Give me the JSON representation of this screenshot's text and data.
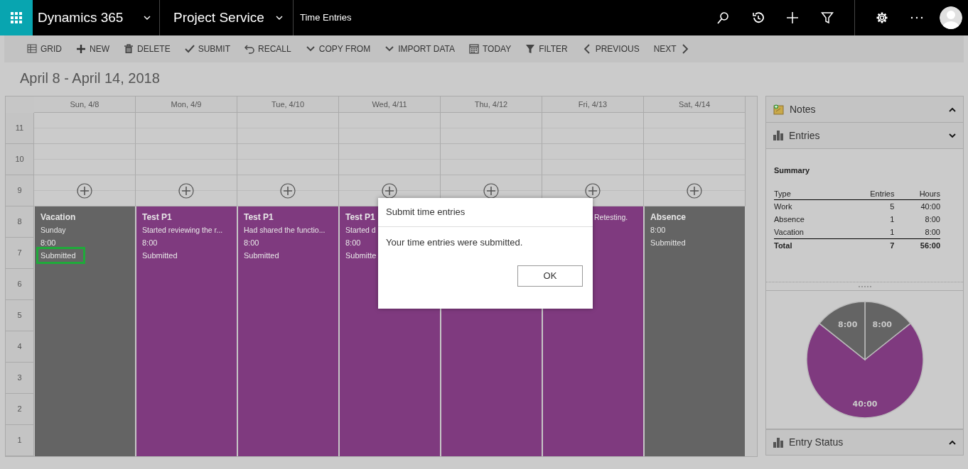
{
  "app_bar": {
    "app_name": "Dynamics 365",
    "area": "Project Service",
    "page": "Time Entries"
  },
  "toolbar": [
    {
      "label": "GRID"
    },
    {
      "label": "NEW"
    },
    {
      "label": "DELETE"
    },
    {
      "label": "SUBMIT"
    },
    {
      "label": "RECALL"
    },
    {
      "label": "COPY FROM"
    },
    {
      "label": "IMPORT DATA"
    },
    {
      "label": "TODAY"
    },
    {
      "label": "FILTER"
    },
    {
      "label": "PREVIOUS"
    },
    {
      "label": "NEXT"
    }
  ],
  "date_range": "April 8 - April 14, 2018",
  "calendar": {
    "hours": [
      "11",
      "10",
      "9",
      "8",
      "7",
      "6",
      "5",
      "4",
      "3",
      "2",
      "1"
    ],
    "days": [
      {
        "label": "Sun, 4/8",
        "entry": {
          "kind": "vacation",
          "title": "Vacation",
          "description": "Sunday",
          "hours": "8:00",
          "status": "Submitted",
          "highlighted": true
        }
      },
      {
        "label": "Mon, 4/9",
        "entry": {
          "kind": "work",
          "title": "Test P1",
          "description": "Started reviewing the r...",
          "hours": "8:00",
          "status": "Submitted",
          "highlighted": false
        }
      },
      {
        "label": "Tue, 4/10",
        "entry": {
          "kind": "work",
          "title": "Test P1",
          "description": "Had shared the functio...",
          "hours": "8:00",
          "status": "Submitted",
          "highlighted": false
        }
      },
      {
        "label": "Wed, 4/11",
        "entry": {
          "kind": "work",
          "title": "Test P1",
          "description": "Started d",
          "hours": "8:00",
          "status": "Submitte",
          "highlighted": false
        }
      },
      {
        "label": "Thu, 4/12",
        "entry": {
          "kind": "work"
        }
      },
      {
        "label": "Fri, 4/13",
        "entry": {
          "kind": "work",
          "description": "Retesting.",
          "behind_dialog": true
        }
      },
      {
        "label": "Sat, 4/14",
        "entry": {
          "kind": "absence",
          "title": "Absence",
          "hours": "8:00",
          "status": "Submitted",
          "highlighted": false
        }
      }
    ]
  },
  "side_panel": {
    "notes": {
      "title": "Notes",
      "expanded": false
    },
    "entries": {
      "title": "Entries",
      "expanded": true,
      "summary_title": "Summary",
      "columns": [
        "Type",
        "Entries",
        "Hours"
      ],
      "rows": [
        [
          "Work",
          "5",
          "40:00"
        ],
        [
          "Absence",
          "1",
          "8:00"
        ],
        [
          "Vacation",
          "1",
          "8:00"
        ]
      ],
      "total": [
        "Total",
        "7",
        "56:00"
      ],
      "chart_data": {
        "type": "pie",
        "values": [
          8,
          40,
          8
        ],
        "colors": [
          "#646464",
          "#7f3a7f",
          "#646464"
        ],
        "data_labels": true,
        "value_labels": [
          "8:00",
          "40:00",
          "8:00"
        ]
      }
    },
    "entry_status": {
      "title": "Entry Status",
      "expanded": false
    }
  },
  "dialog": {
    "title": "Submit time entries",
    "message": "Your time entries were submitted.",
    "button": "OK"
  }
}
